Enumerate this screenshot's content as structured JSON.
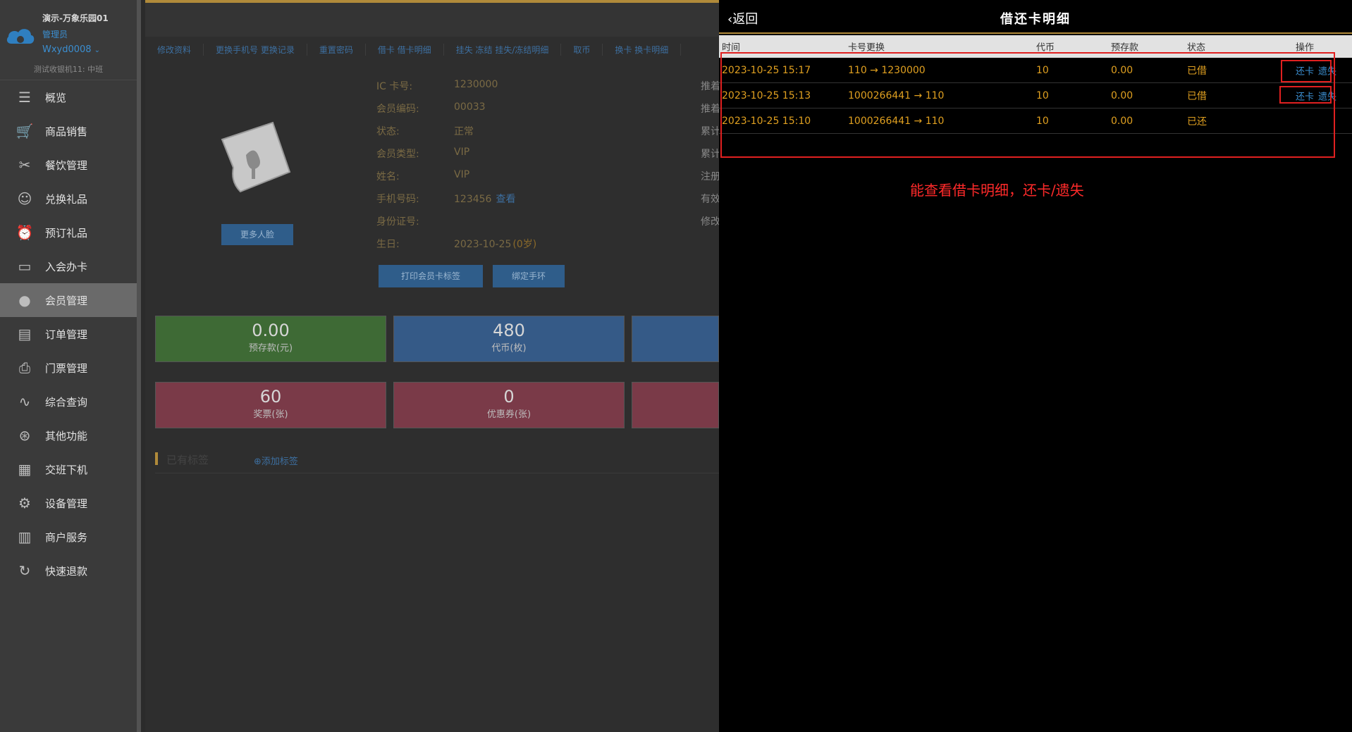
{
  "sidebar": {
    "store_name": "演示-万象乐园01",
    "role": "管理员",
    "user": "Wxyd0008",
    "terminal": "测试收银机11: 中班",
    "items": [
      {
        "label": "概览",
        "icon": "menu-icon"
      },
      {
        "label": "商品销售",
        "icon": "cart-icon"
      },
      {
        "label": "餐饮管理",
        "icon": "utensils-icon"
      },
      {
        "label": "兑换礼品",
        "icon": "gift-icon"
      },
      {
        "label": "预订礼品",
        "icon": "alarm-clock-icon"
      },
      {
        "label": "入会办卡",
        "icon": "card-icon"
      },
      {
        "label": "会员管理",
        "icon": "user-icon",
        "active": true
      },
      {
        "label": "订单管理",
        "icon": "clipboard-icon"
      },
      {
        "label": "门票管理",
        "icon": "printer-icon"
      },
      {
        "label": "综合查询",
        "icon": "pulse-icon"
      },
      {
        "label": "其他功能",
        "icon": "aperture-icon"
      },
      {
        "label": "交班下机",
        "icon": "calculator-icon"
      },
      {
        "label": "设备管理",
        "icon": "gear-icon"
      },
      {
        "label": "商户服务",
        "icon": "document-icon"
      },
      {
        "label": "快速退款",
        "icon": "refresh-icon"
      }
    ]
  },
  "main": {
    "tabs": [
      "修改资料",
      "更换手机号 更换记录",
      "重置密码",
      "借卡 借卡明细",
      "挂失 冻结 挂失/冻结明细",
      "取币",
      "换卡 换卡明细"
    ],
    "face_button": "更多人脸",
    "info": [
      {
        "label": "IC 卡号:",
        "value": "1230000"
      },
      {
        "label": "会员编码:",
        "value": "00033"
      },
      {
        "label": "状态:",
        "value": "正常"
      },
      {
        "label": "会员类型:",
        "value": "VIP"
      },
      {
        "label": "姓名:",
        "value": "VIP"
      },
      {
        "label": "手机号码:",
        "value": "123456",
        "link": "查看"
      },
      {
        "label": "身份证号:",
        "value": ""
      },
      {
        "label": "生日:",
        "value": "2023-10-25",
        "age": "(0岁)"
      }
    ],
    "right_labels": [
      "推着",
      "推着",
      "累计",
      "累计",
      "注册",
      "有效",
      "修改"
    ],
    "print_button": "打印会员卡标签",
    "bind_button": "绑定手环",
    "stats_row1": [
      {
        "num": "0.00",
        "label": "预存款(元)",
        "color": "#3e6a35"
      },
      {
        "num": "480",
        "label": "代币(枚)",
        "color": "#355a87"
      }
    ],
    "stats_row2": [
      {
        "num": "60",
        "label": "奖票(张)",
        "color": "#7a3a48"
      },
      {
        "num": "0",
        "label": "优惠券(张)",
        "color": "#7a3a48"
      }
    ],
    "tags_title": "已有标签",
    "tags_add": "添加标签"
  },
  "drawer": {
    "back": "返回",
    "title": "借还卡明细",
    "columns": [
      "时间",
      "卡号更换",
      "代币",
      "预存款",
      "状态",
      "操作"
    ],
    "rows": [
      {
        "time": "2023-10-25 15:17",
        "card": "110 → 1230000",
        "coin": "10",
        "deposit": "0.00",
        "status": "已借",
        "ops": [
          "还卡",
          "遗失"
        ]
      },
      {
        "time": "2023-10-25 15:13",
        "card": "1000266441 → 110",
        "coin": "10",
        "deposit": "0.00",
        "status": "已借",
        "ops": [
          "还卡",
          "遗失"
        ]
      },
      {
        "time": "2023-10-25 15:10",
        "card": "1000266441 → 110",
        "coin": "10",
        "deposit": "0.00",
        "status": "已还",
        "ops": []
      }
    ],
    "note": "能查看借卡明细，还卡/遗失"
  }
}
